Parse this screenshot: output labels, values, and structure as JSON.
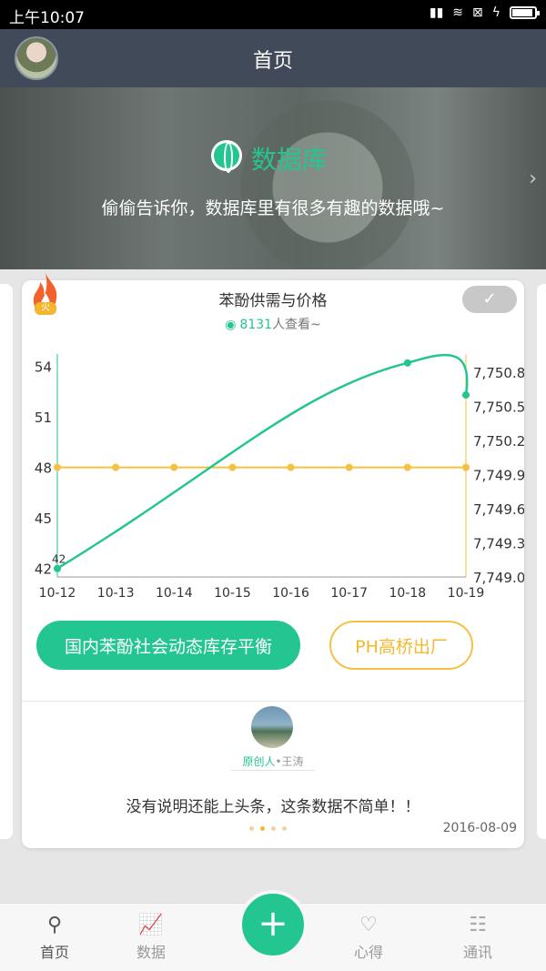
{
  "status": {
    "time": "上午10:07",
    "battery_level": 0.9
  },
  "appbar": {
    "title": "首页"
  },
  "banner": {
    "title": "数据库",
    "subtitle": "偷偷告诉你，数据库里有很多有趣的数据哦~"
  },
  "card": {
    "badge": "火",
    "title": "苯酚供需与价格",
    "views_count": "8131",
    "views_suffix": "人查看~",
    "check_icon": "✓",
    "tags": [
      "国内苯酚社会动态库存平衡",
      "PH高桥出厂"
    ],
    "author_label": "原创人",
    "author_name": "•王涛",
    "description": "没有说明还能上头条，这条数据不简单！！",
    "date": "2016-08-09",
    "pager": {
      "count": 4,
      "active": 1
    }
  },
  "chart_data": {
    "type": "line",
    "categories": [
      "10-12",
      "10-13",
      "10-14",
      "10-15",
      "10-16",
      "10-17",
      "10-18",
      "10-19"
    ],
    "left_axis": {
      "ticks": [
        "42",
        "45",
        "48",
        "51",
        "54"
      ],
      "range": [
        41.5,
        55
      ]
    },
    "right_axis": {
      "ticks": [
        "7,749.0",
        "7,749.3",
        "7,749.6",
        "7,749.9",
        "7,750.2",
        "7,750.5",
        "7,750.8"
      ],
      "range": [
        7749.0,
        7751.0
      ]
    },
    "series": [
      {
        "axis": "left",
        "color": "#23c690",
        "points": [
          [
            0,
            42
          ],
          [
            6,
            54.2
          ],
          [
            7,
            52.3
          ]
        ],
        "first_label": "42"
      },
      {
        "axis": "left",
        "color": "#f5c142",
        "values": [
          48,
          48,
          48,
          48,
          48,
          48,
          48,
          48
        ]
      }
    ]
  },
  "tabbar": {
    "items": [
      {
        "label": "首页",
        "icon": "home-icon",
        "glyph": "⚲"
      },
      {
        "label": "数据",
        "icon": "chart-icon",
        "glyph": "📈"
      },
      {
        "label": "心得",
        "icon": "heart-icon",
        "glyph": "♡"
      },
      {
        "label": "通讯",
        "icon": "contacts-icon",
        "glyph": "☷"
      }
    ],
    "fab": "+"
  }
}
